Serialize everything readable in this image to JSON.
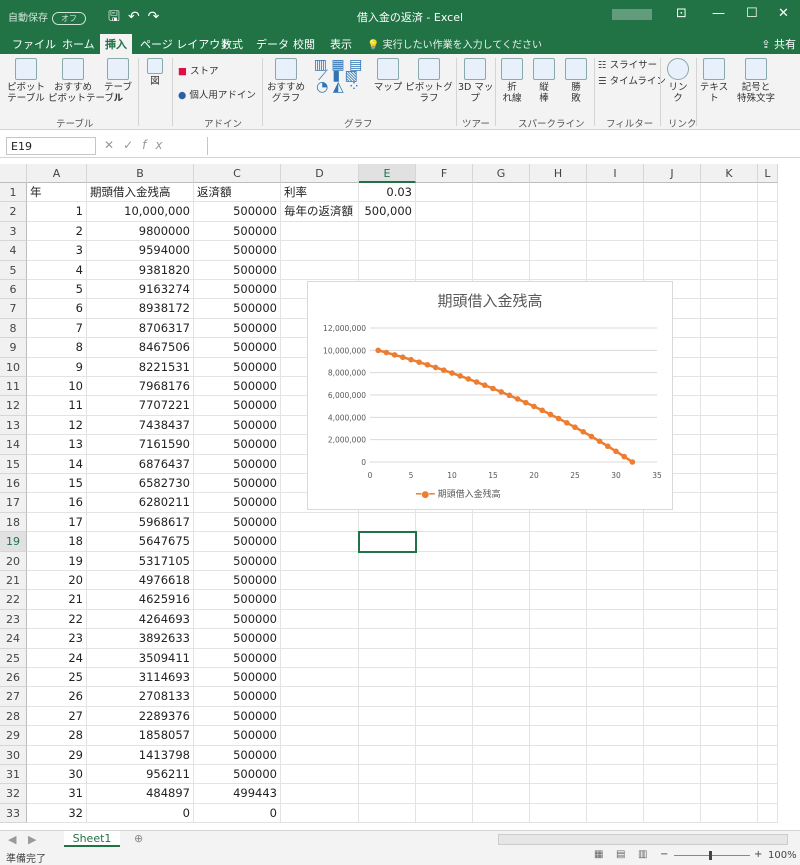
{
  "window": {
    "autosave_label": "自動保存",
    "autosave_state": "オフ",
    "title": "借入金の返済 - Excel",
    "min": "—",
    "max": "☐",
    "close": "✕"
  },
  "tabs": [
    "ファイル",
    "ホーム",
    "挿入",
    "ページ レイアウト",
    "数式",
    "データ",
    "校閲",
    "表示"
  ],
  "active_tab": "挿入",
  "tell_me": "実行したい作業を入力してください",
  "share": "共有",
  "ribbon": {
    "pivot": "ピボット\nテーブル",
    "recommended_pivot": "おすすめ\nピボットテーブル",
    "table": "テーブル",
    "illustrations": "図",
    "group_table": "テーブル",
    "store": "ストア",
    "my_addins": "個人用アドイン",
    "group_addins": "アドイン",
    "recommended_charts": "おすすめ\nグラフ",
    "group_charts": "グラフ",
    "map": "マップ",
    "pivot_chart": "ピボットグラフ",
    "map3d": "3D マッ\nプ",
    "group_tours": "ツアー",
    "spark_line": "折\nれ線",
    "spark_column": "縦\n棒",
    "spark_winloss": "勝\n敗",
    "group_sparklines": "スパークライン",
    "slicer": "スライサー",
    "timeline": "タイムライン",
    "group_filter": "フィルター",
    "link": "リンク",
    "group_links": "リンク",
    "text": "テキスト",
    "symbols": "記号と\n特殊文字"
  },
  "name_box": "E19",
  "formula_bar": "",
  "columns": [
    "A",
    "B",
    "C",
    "D",
    "E",
    "F",
    "G",
    "H",
    "I",
    "J",
    "K",
    "L"
  ],
  "selected_column": "E",
  "selected_row": "19",
  "headers": {
    "A": "年",
    "B": "期頭借入金残高",
    "C": "返済額",
    "D": "利率",
    "E": "0.03"
  },
  "row2_extra": {
    "D": "毎年の返済額",
    "E": "500,000"
  },
  "rows": [
    {
      "r": "2",
      "A": "1",
      "B": "10,000,000",
      "C": "500000"
    },
    {
      "r": "3",
      "A": "2",
      "B": "9800000",
      "C": "500000"
    },
    {
      "r": "4",
      "A": "3",
      "B": "9594000",
      "C": "500000"
    },
    {
      "r": "5",
      "A": "4",
      "B": "9381820",
      "C": "500000"
    },
    {
      "r": "6",
      "A": "5",
      "B": "9163274",
      "C": "500000"
    },
    {
      "r": "7",
      "A": "6",
      "B": "8938172",
      "C": "500000"
    },
    {
      "r": "8",
      "A": "7",
      "B": "8706317",
      "C": "500000"
    },
    {
      "r": "9",
      "A": "8",
      "B": "8467506",
      "C": "500000"
    },
    {
      "r": "10",
      "A": "9",
      "B": "8221531",
      "C": "500000"
    },
    {
      "r": "11",
      "A": "10",
      "B": "7968176",
      "C": "500000"
    },
    {
      "r": "12",
      "A": "11",
      "B": "7707221",
      "C": "500000"
    },
    {
      "r": "13",
      "A": "12",
      "B": "7438437",
      "C": "500000"
    },
    {
      "r": "14",
      "A": "13",
      "B": "7161590",
      "C": "500000"
    },
    {
      "r": "15",
      "A": "14",
      "B": "6876437",
      "C": "500000"
    },
    {
      "r": "16",
      "A": "15",
      "B": "6582730",
      "C": "500000"
    },
    {
      "r": "17",
      "A": "16",
      "B": "6280211",
      "C": "500000"
    },
    {
      "r": "18",
      "A": "17",
      "B": "5968617",
      "C": "500000"
    },
    {
      "r": "19",
      "A": "18",
      "B": "5647675",
      "C": "500000"
    },
    {
      "r": "20",
      "A": "19",
      "B": "5317105",
      "C": "500000"
    },
    {
      "r": "21",
      "A": "20",
      "B": "4976618",
      "C": "500000"
    },
    {
      "r": "22",
      "A": "21",
      "B": "4625916",
      "C": "500000"
    },
    {
      "r": "23",
      "A": "22",
      "B": "4264693",
      "C": "500000"
    },
    {
      "r": "24",
      "A": "23",
      "B": "3892633",
      "C": "500000"
    },
    {
      "r": "25",
      "A": "24",
      "B": "3509411",
      "C": "500000"
    },
    {
      "r": "26",
      "A": "25",
      "B": "3114693",
      "C": "500000"
    },
    {
      "r": "27",
      "A": "26",
      "B": "2708133",
      "C": "500000"
    },
    {
      "r": "28",
      "A": "27",
      "B": "2289376",
      "C": "500000"
    },
    {
      "r": "29",
      "A": "28",
      "B": "1858057",
      "C": "500000"
    },
    {
      "r": "30",
      "A": "29",
      "B": "1413798",
      "C": "500000"
    },
    {
      "r": "31",
      "A": "30",
      "B": "956211",
      "C": "500000"
    },
    {
      "r": "32",
      "A": "31",
      "B": "484897",
      "C": "499443"
    },
    {
      "r": "33",
      "A": "32",
      "B": "0",
      "C": "0"
    }
  ],
  "chart_data": {
    "type": "line",
    "title": "期頭借入金残高",
    "x": [
      1,
      2,
      3,
      4,
      5,
      6,
      7,
      8,
      9,
      10,
      11,
      12,
      13,
      14,
      15,
      16,
      17,
      18,
      19,
      20,
      21,
      22,
      23,
      24,
      25,
      26,
      27,
      28,
      29,
      30,
      31,
      32
    ],
    "series": [
      {
        "name": "期頭借入金残高",
        "values": [
          10000000,
          9800000,
          9594000,
          9381820,
          9163274,
          8938172,
          8706317,
          8467506,
          8221531,
          7968176,
          7707221,
          7438437,
          7161590,
          6876437,
          6582730,
          6280211,
          5968617,
          5647675,
          5317105,
          4976618,
          4625916,
          4264693,
          3892633,
          3509411,
          3114693,
          2708133,
          2289376,
          1858057,
          1413798,
          956211,
          484897,
          0
        ]
      }
    ],
    "yticks": [
      "0",
      "2,000,000",
      "4,000,000",
      "6,000,000",
      "8,000,000",
      "10,000,000",
      "12,000,000"
    ],
    "xticks": [
      "0",
      "5",
      "10",
      "15",
      "20",
      "25",
      "30",
      "35"
    ],
    "xlim": [
      0,
      35
    ],
    "ylim": [
      0,
      12000000
    ],
    "color": "#ED7D31",
    "legend": "bottom",
    "grid": true
  },
  "sheet_tab": "Sheet1",
  "status": "準備完了",
  "zoom": "100%"
}
